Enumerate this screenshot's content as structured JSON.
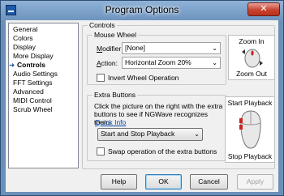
{
  "window": {
    "title": "Program Options",
    "close_glyph": "✕"
  },
  "nav": {
    "items": [
      {
        "label": "General",
        "active": false
      },
      {
        "label": "Colors",
        "active": false
      },
      {
        "label": "Display",
        "active": false
      },
      {
        "label": "More Display",
        "active": false
      },
      {
        "label": "Controls",
        "active": true
      },
      {
        "label": "Audio Settings",
        "active": false
      },
      {
        "label": "FFT Settings",
        "active": false
      },
      {
        "label": "Advanced",
        "active": false
      },
      {
        "label": "MIDI Control",
        "active": false
      },
      {
        "label": "Scrub Wheel",
        "active": false
      }
    ]
  },
  "controls": {
    "group_title": "Controls",
    "mouse_wheel": {
      "title": "Mouse Wheel",
      "modifier_label": "Modifier:",
      "modifier_value": "[None]",
      "action_label": "Action:",
      "action_value": "Horizontal Zoom 20%",
      "invert_label": "Invert Wheel Operation",
      "invert_checked": false,
      "zoom_in_label": "Zoom In",
      "zoom_out_label": "Zoom Out"
    },
    "extra_buttons": {
      "title": "Extra Buttons",
      "description": "Click the picture on the right with the extra buttons to see if NGWave recognizes them.",
      "quick_info_link": "Quick Info",
      "playback_value": "Start and Stop Playback",
      "swap_label": "Swap operation of the extra buttons",
      "swap_checked": false,
      "start_playback_label": "Start Playback",
      "stop_playback_label": "Stop Playback"
    }
  },
  "footer": {
    "help": "Help",
    "ok": "OK",
    "cancel": "Cancel",
    "apply": "Apply"
  }
}
